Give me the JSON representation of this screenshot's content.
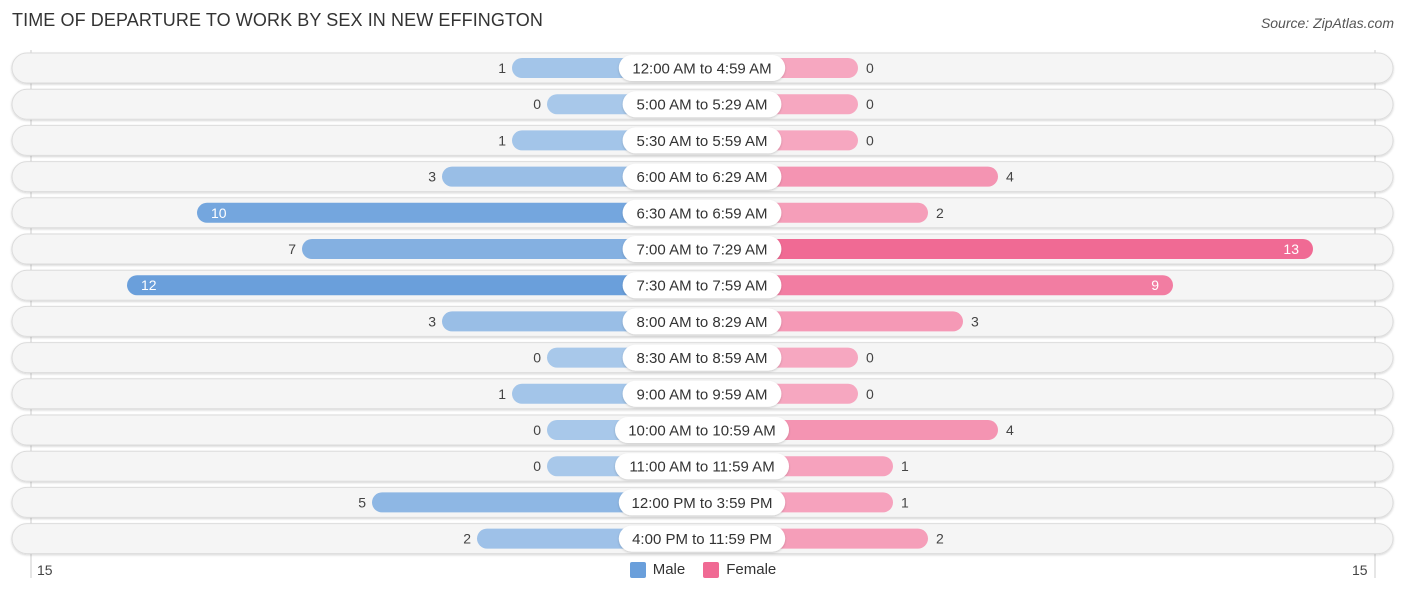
{
  "header": {
    "title": "TIME OF DEPARTURE TO WORK BY SEX IN NEW EFFINGTON",
    "source": "Source: ZipAtlas.com"
  },
  "colors": {
    "male_strong": "#6a9fdb",
    "male_light": "#a8c8ea",
    "female_strong": "#f06a94",
    "female_light": "#f6a7c0",
    "row_bg": "#f2f2f2"
  },
  "chart_data": {
    "type": "bar",
    "orientation": "horizontal-diverging",
    "title": "TIME OF DEPARTURE TO WORK BY SEX IN NEW EFFINGTON",
    "categories": [
      "12:00 AM to 4:59 AM",
      "5:00 AM to 5:29 AM",
      "5:30 AM to 5:59 AM",
      "6:00 AM to 6:29 AM",
      "6:30 AM to 6:59 AM",
      "7:00 AM to 7:29 AM",
      "7:30 AM to 7:59 AM",
      "8:00 AM to 8:29 AM",
      "8:30 AM to 8:59 AM",
      "9:00 AM to 9:59 AM",
      "10:00 AM to 10:59 AM",
      "11:00 AM to 11:59 AM",
      "12:00 PM to 3:59 PM",
      "4:00 PM to 11:59 PM"
    ],
    "series": [
      {
        "name": "Male",
        "values": [
          1,
          0,
          1,
          3,
          10,
          7,
          12,
          3,
          0,
          1,
          0,
          0,
          5,
          2
        ]
      },
      {
        "name": "Female",
        "values": [
          0,
          0,
          0,
          4,
          2,
          13,
          9,
          3,
          0,
          0,
          4,
          1,
          1,
          2
        ]
      }
    ],
    "axis": {
      "left_label": "15",
      "right_label": "15",
      "max": 15
    },
    "legend": {
      "position": "bottom-center",
      "entries": [
        "Male",
        "Female"
      ]
    }
  }
}
